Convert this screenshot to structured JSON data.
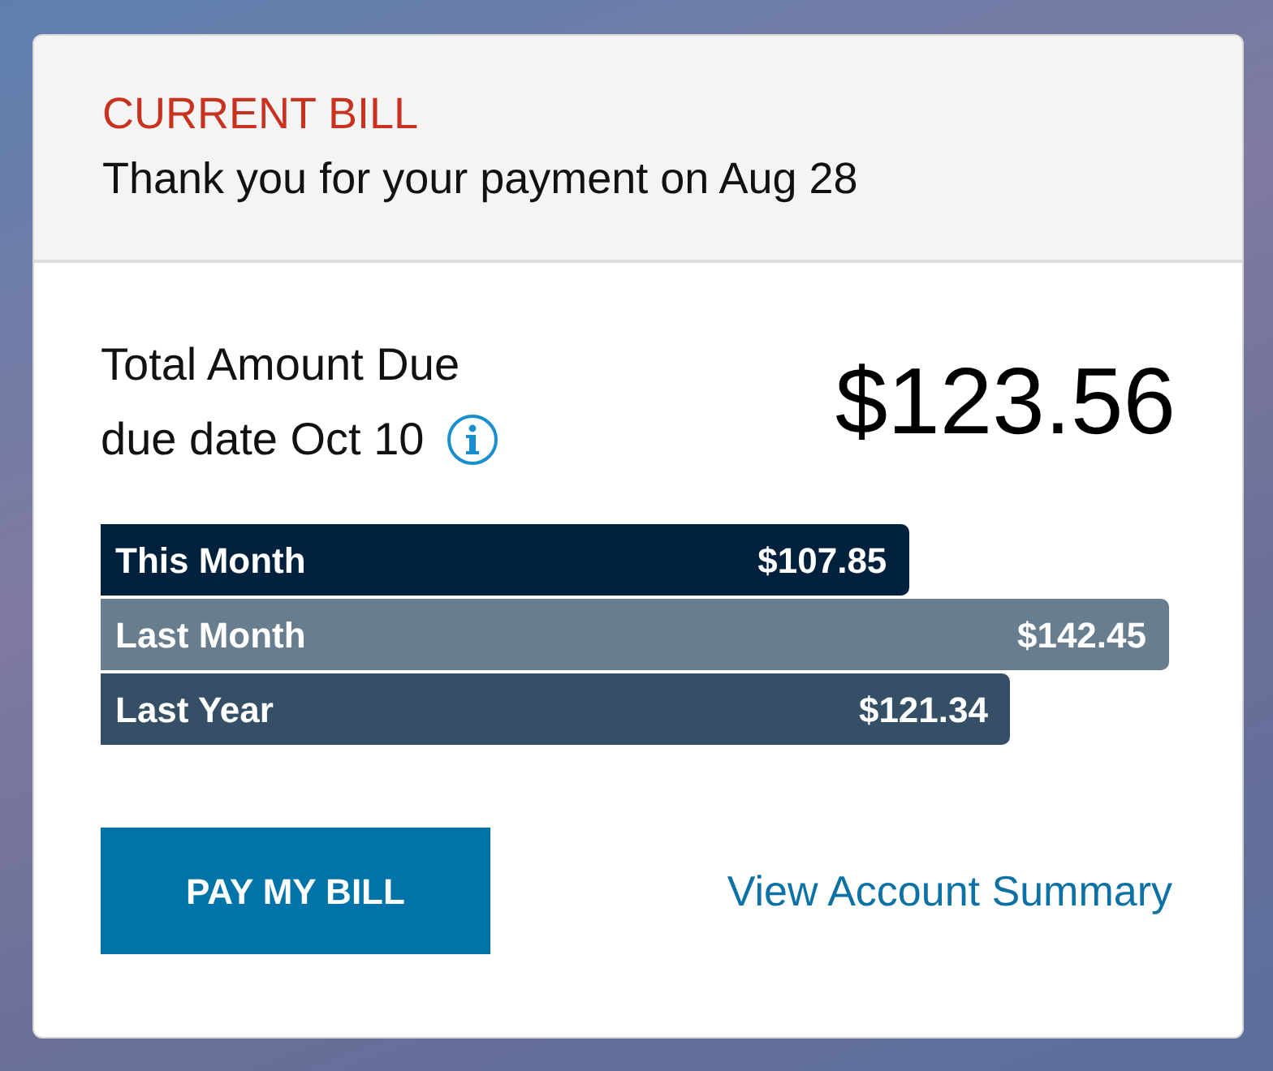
{
  "header": {
    "title": "CURRENT BILL",
    "message": "Thank you for your payment on Aug 28"
  },
  "amount": {
    "label": "Total Amount Due",
    "due_date": "due date Oct 10",
    "total": "$123.56"
  },
  "bars": [
    {
      "label": "This Month",
      "value": "$107.85",
      "color": "#00213d"
    },
    {
      "label": "Last Month",
      "value": "$142.45",
      "color": "#687d8d"
    },
    {
      "label": "Last Year",
      "value": "$121.34",
      "color": "#344f66"
    }
  ],
  "actions": {
    "button": "PAY MY BILL",
    "link": "View Account Summary"
  }
}
